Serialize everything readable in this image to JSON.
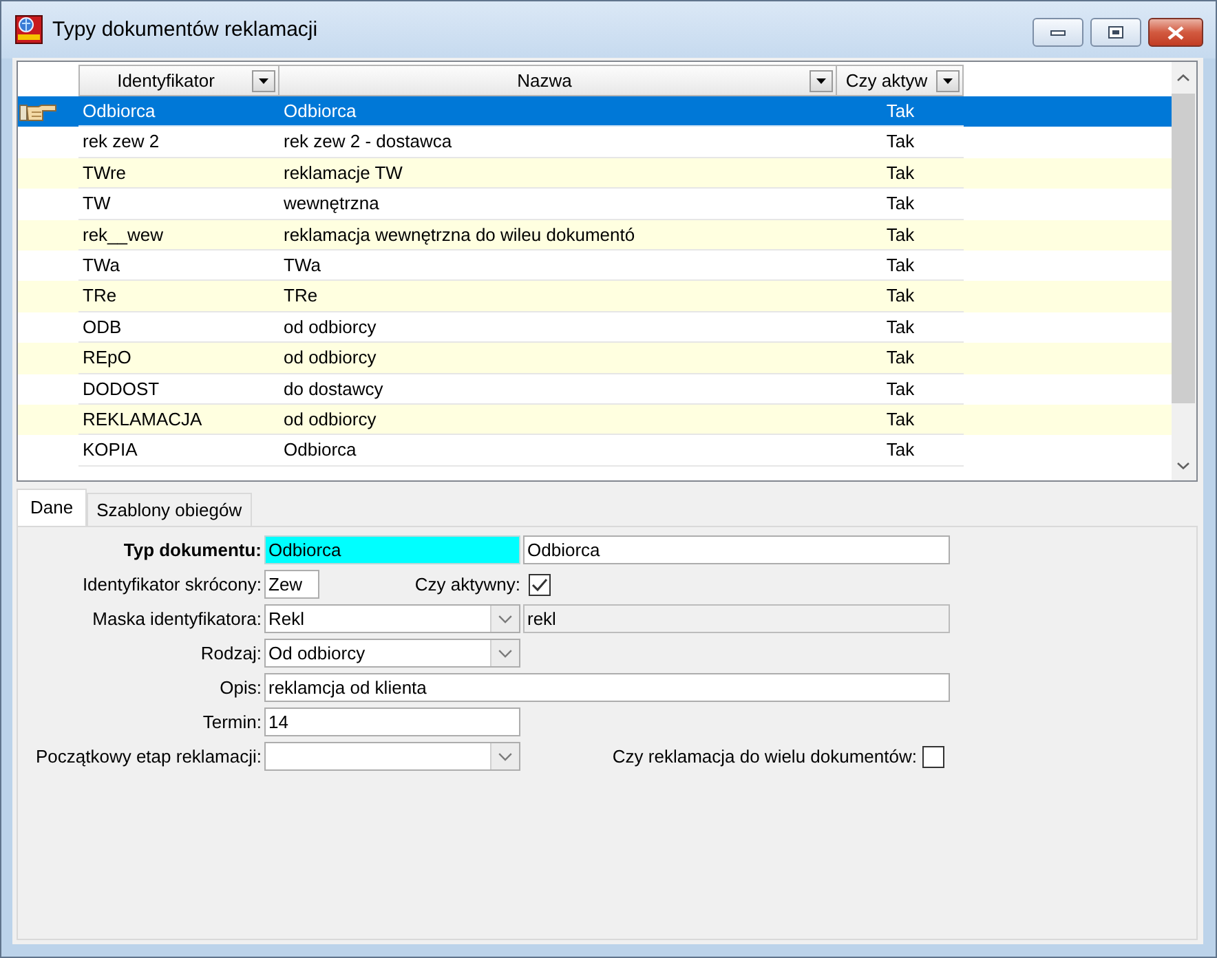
{
  "window": {
    "title": "Typy dokumentów reklamacji"
  },
  "grid": {
    "columns": [
      "Identyfikator",
      "Nazwa",
      "Czy aktyw"
    ],
    "rows": [
      {
        "identifier": "Odbiorca",
        "name": "Odbiorca",
        "active": "Tak",
        "selected": true
      },
      {
        "identifier": "rek zew 2",
        "name": "rek zew 2 - dostawca",
        "active": "Tak",
        "selected": false
      },
      {
        "identifier": "TWre",
        "name": "reklamacje TW",
        "active": "Tak",
        "selected": false
      },
      {
        "identifier": "TW",
        "name": "wewnętrzna",
        "active": "Tak",
        "selected": false
      },
      {
        "identifier": "rek__wew",
        "name": "reklamacja wewnętrzna do wileu dokumentó",
        "active": "Tak",
        "selected": false
      },
      {
        "identifier": "TWa",
        "name": "TWa",
        "active": "Tak",
        "selected": false
      },
      {
        "identifier": "TRe",
        "name": "TRe",
        "active": "Tak",
        "selected": false
      },
      {
        "identifier": "ODB",
        "name": "od odbiorcy",
        "active": "Tak",
        "selected": false
      },
      {
        "identifier": "REpO",
        "name": "od odbiorcy",
        "active": "Tak",
        "selected": false
      },
      {
        "identifier": "DODOST",
        "name": "do dostawcy",
        "active": "Tak",
        "selected": false
      },
      {
        "identifier": "REKLAMACJA",
        "name": "od odbiorcy",
        "active": "Tak",
        "selected": false
      },
      {
        "identifier": "KOPIA",
        "name": "Odbiorca",
        "active": "Tak",
        "selected": false
      }
    ]
  },
  "tabs": [
    {
      "label": "Dane",
      "selected": true
    },
    {
      "label": "Szablony obiegów",
      "selected": false
    }
  ],
  "form": {
    "document_type": {
      "label": "Typ dokumentu:",
      "code": "Odbiorca",
      "name": "Odbiorca",
      "focused": true
    },
    "short_id": {
      "label": "Identyfikator skrócony:",
      "value": "Zew"
    },
    "active": {
      "label": "Czy aktywny:",
      "checked": true
    },
    "id_mask": {
      "label": "Maska identyfikatora:",
      "value": "Rekl",
      "preview": "rekl",
      "preview_disabled": true
    },
    "category": {
      "label": "Rodzaj:",
      "value": "Od odbiorcy"
    },
    "description": {
      "label": "Opis:",
      "value": "reklamcja od klienta"
    },
    "deadline": {
      "label": "Termin:",
      "value": "14"
    },
    "initial_stage": {
      "label": "Początkowy etap reklamacji:"
    },
    "multi_document": {
      "label": "Czy reklamacja do wielu dokumentów:",
      "checked": false
    }
  }
}
